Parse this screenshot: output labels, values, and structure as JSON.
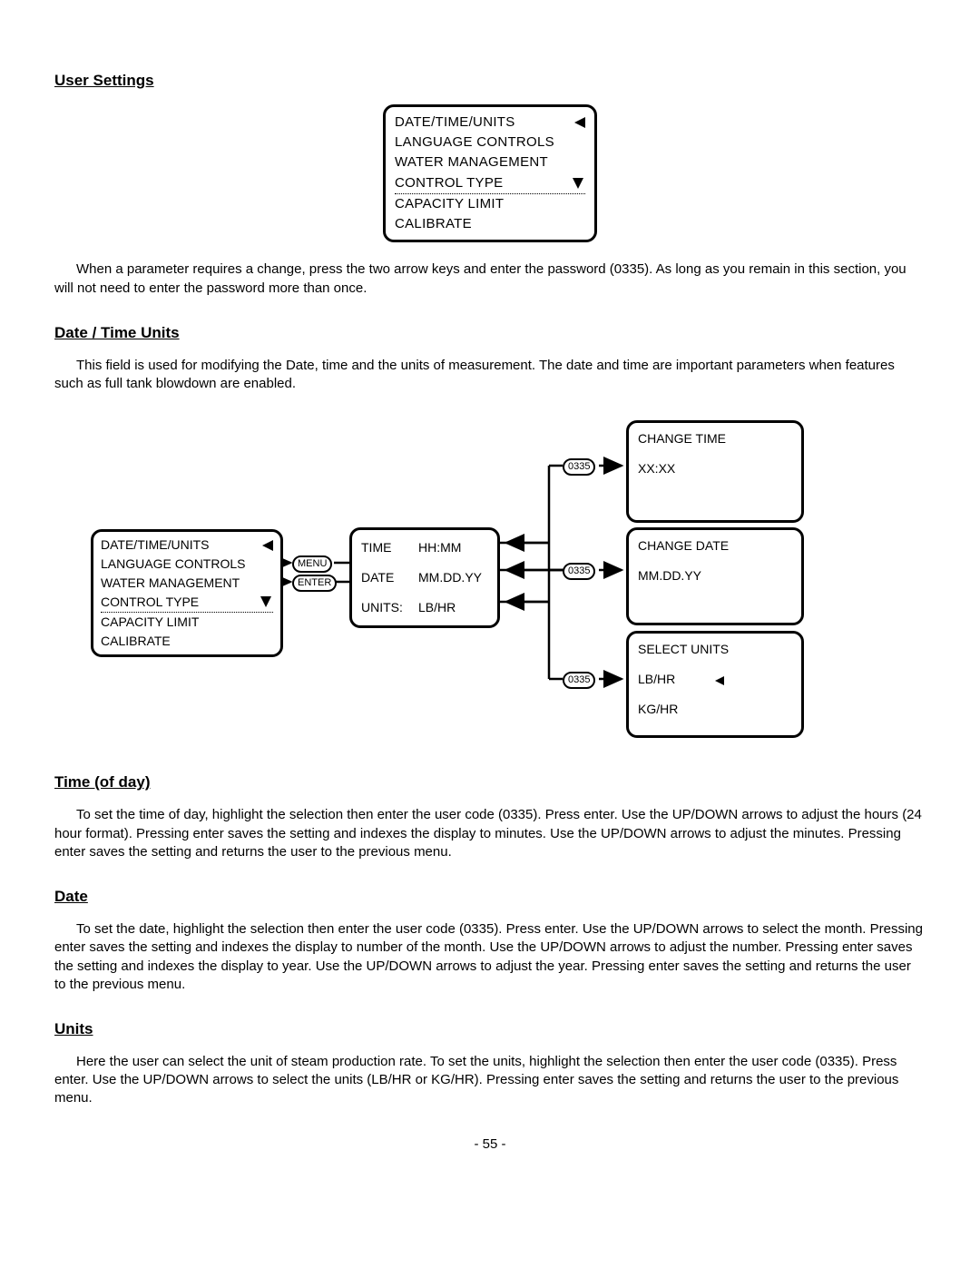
{
  "sections": {
    "user_settings": {
      "title": "User Settings"
    },
    "date_time_units": {
      "title": "Date / Time Units"
    },
    "time_of_day": {
      "title": "Time (of day)"
    },
    "date": {
      "title": "Date"
    },
    "units": {
      "title": "Units"
    }
  },
  "menu": {
    "items": [
      "DATE/TIME/UNITS",
      "LANGUAGE CONTROLS",
      "WATER MANAGEMENT",
      "CONTROL TYPE",
      "CAPACITY LIMIT",
      "CALIBRATE"
    ]
  },
  "paragraphs": {
    "user_settings": "When a parameter requires a change, press the two arrow keys and enter the password (0335).  As long as you remain in this section, you will not need to enter the password more than once.",
    "date_time_units": "This field is used for modifying the Date, time and the units of measurement. The date and time are important parameters when features such as full tank blowdown are enabled.",
    "time_of_day": "To set the time of day, highlight the selection then enter the user code (0335). Press enter. Use the UP/DOWN arrows to adjust the hours (24 hour format). Pressing enter saves the setting and indexes the display to minutes. Use the UP/DOWN arrows to adjust the minutes. Pressing enter saves the setting and returns the user to the previous menu.",
    "date": "To set the date, highlight the selection then enter the user code (0335). Press enter. Use the UP/DOWN arrows to select the month. Pressing enter saves the setting and indexes the display to number of the month. Use the UP/DOWN arrows to adjust the number. Pressing enter saves the setting and indexes the display to year. Use the UP/DOWN arrows to adjust the year. Pressing enter saves the setting and returns the user to the previous menu.",
    "units": "Here the user can select the unit of steam production rate. To set the units, highlight the selection then enter the user code (0335). Press enter. Use the UP/DOWN arrows to select the units (LB/HR or KG/HR). Pressing enter saves the setting and returns the user to the previous menu."
  },
  "diagram": {
    "pills": {
      "menu": "MENU",
      "enter": "ENTER",
      "code": "0335"
    },
    "center": {
      "time_label": "TIME",
      "time_val": "HH:MM",
      "date_label": "DATE",
      "date_val": "MM.DD.YY",
      "units_label": "UNITS:",
      "units_val": "LB/HR"
    },
    "right": {
      "change_time": {
        "title": "CHANGE TIME",
        "val": "XX:XX"
      },
      "change_date": {
        "title": "CHANGE DATE",
        "val": "MM.DD.YY"
      },
      "select_units": {
        "title": "SELECT UNITS",
        "opt1": "LB/HR",
        "opt2": "KG/HR"
      }
    }
  },
  "page_number": "- 55 -"
}
